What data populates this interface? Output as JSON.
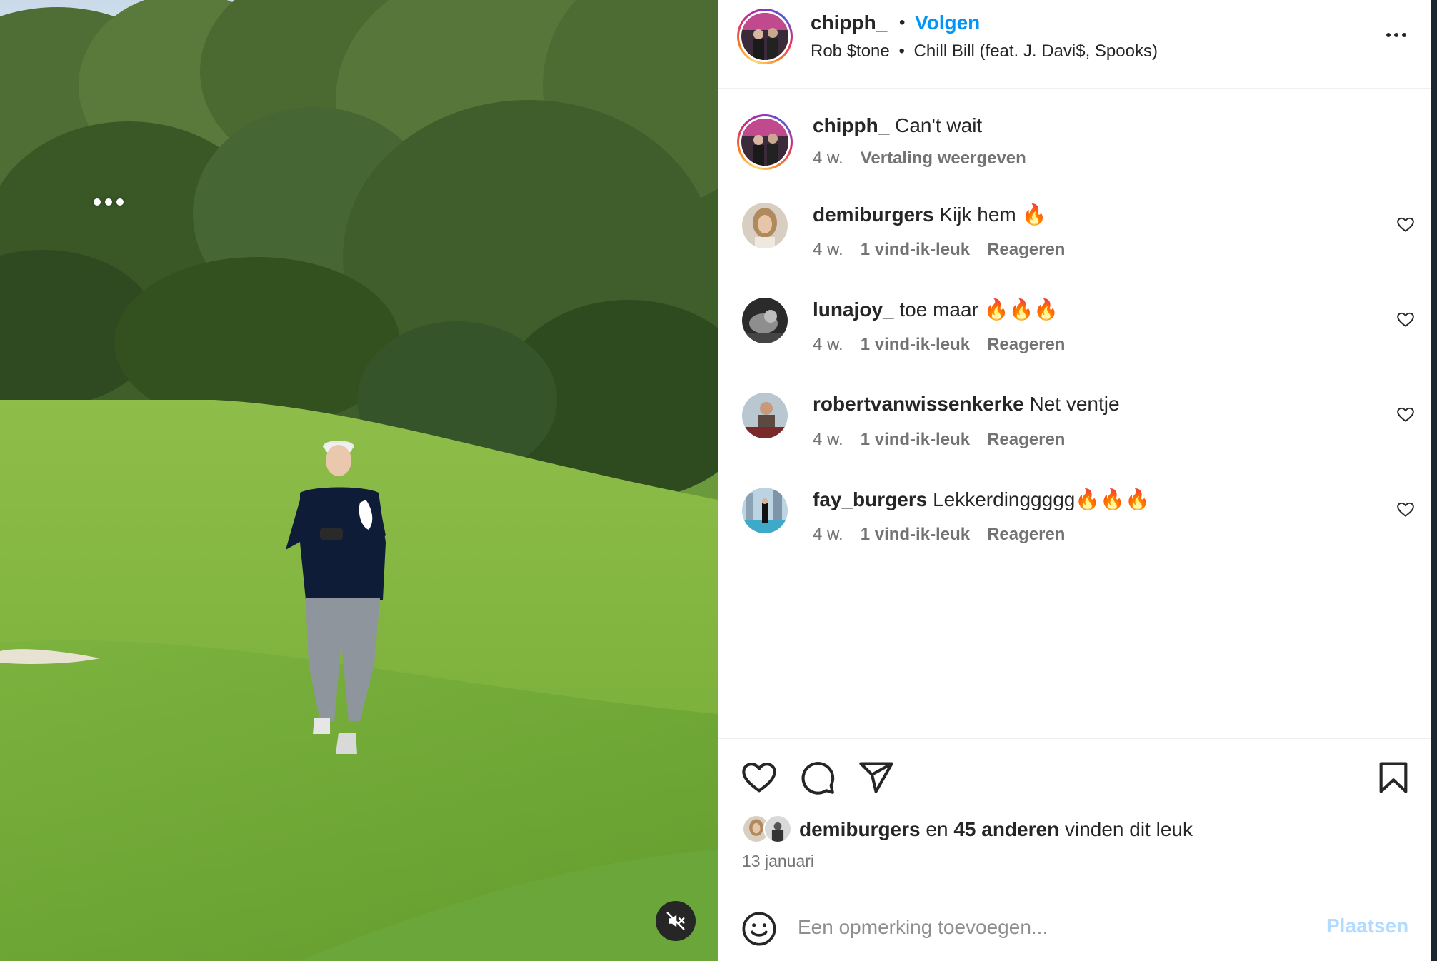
{
  "media": {
    "more_icon": "more-horizontal-icon",
    "mute_icon": "speaker-muted-icon"
  },
  "post_header": {
    "username": "chipph_",
    "separator": "•",
    "follow_label": "Volgen",
    "audio_artist": "Rob $tone",
    "audio_separator": "•",
    "audio_track": "Chill Bill (feat. J. Davi$, Spooks)",
    "more_icon": "more-horizontal-icon"
  },
  "caption": {
    "username": "chipph_",
    "text": "Can't wait",
    "time": "4 w.",
    "translate_label": "Vertaling weergeven"
  },
  "comments": [
    {
      "username": "demiburgers",
      "text": "Kijk hem 🔥",
      "time": "4 w.",
      "likes": "1 vind-ik-leuk",
      "reply_label": "Reageren"
    },
    {
      "username": "lunajoy_",
      "text": "toe maar 🔥🔥🔥",
      "time": "4 w.",
      "likes": "1 vind-ik-leuk",
      "reply_label": "Reageren"
    },
    {
      "username": "robertvanwissenkerke",
      "text": "Net ventje",
      "time": "4 w.",
      "likes": "1 vind-ik-leuk",
      "reply_label": "Reageren"
    },
    {
      "username": "fay_burgers",
      "text": "Lekkerdinggggg🔥🔥🔥",
      "time": "4 w.",
      "likes": "1 vind-ik-leuk",
      "reply_label": "Reageren"
    }
  ],
  "actions": {
    "icons": [
      "heart-icon",
      "comment-icon",
      "share-icon",
      "bookmark-icon"
    ]
  },
  "likes": {
    "first_liker": "demiburgers",
    "connector": "en",
    "others": "45 anderen",
    "suffix": "vinden dit leuk"
  },
  "post_date": "13 januari",
  "add_comment": {
    "placeholder": "Een opmerking toevoegen...",
    "post_label": "Plaatsen"
  },
  "colors": {
    "link_blue": "#0095f6",
    "disabled_blue": "#b3dbff",
    "secondary_text": "#737373",
    "primary_text": "#262626"
  }
}
